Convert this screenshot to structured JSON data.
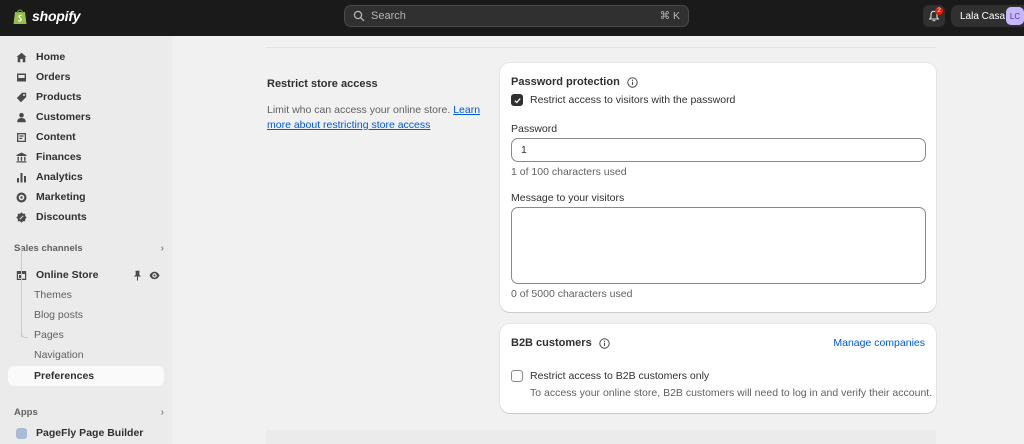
{
  "topbar": {
    "brand": "shopify",
    "search_placeholder": "Search",
    "search_shortcut": "⌘ K",
    "notifications_count": "2",
    "store_name": "Lala Casa",
    "avatar_initials": "LC"
  },
  "sidebar": {
    "items": [
      {
        "label": "Home",
        "icon": "home-icon"
      },
      {
        "label": "Orders",
        "icon": "orders-icon"
      },
      {
        "label": "Products",
        "icon": "products-icon"
      },
      {
        "label": "Customers",
        "icon": "customers-icon"
      },
      {
        "label": "Content",
        "icon": "content-icon"
      },
      {
        "label": "Finances",
        "icon": "finances-icon"
      },
      {
        "label": "Analytics",
        "icon": "analytics-icon"
      },
      {
        "label": "Marketing",
        "icon": "marketing-icon"
      },
      {
        "label": "Discounts",
        "icon": "discounts-icon"
      }
    ],
    "sales_channels_title": "Sales channels",
    "online_store_label": "Online Store",
    "online_store_subitems": [
      "Themes",
      "Blog posts",
      "Pages",
      "Navigation",
      "Preferences"
    ],
    "apps_title": "Apps",
    "app_item_label": "PageFly Page Builder"
  },
  "main": {
    "section_title": "Restrict store access",
    "section_desc": "Limit who can access your online store.",
    "section_link": "Learn more about restricting store access",
    "password_card": {
      "title": "Password protection",
      "checkbox_label": "Restrict access to visitors with the password",
      "password_label": "Password",
      "password_value": "1",
      "password_help": "1 of 100 characters used",
      "message_label": "Message to your visitors",
      "message_help": "0 of 5000 characters used"
    },
    "b2b_card": {
      "title": "B2B customers",
      "manage_link": "Manage companies",
      "checkbox_label": "Restrict access to B2B customers only",
      "checkbox_help": "To access your online store, B2B customers will need to log in and verify their account."
    }
  },
  "colors": {
    "topbar_bg": "#1a1a1a",
    "sidebar_bg": "#ebebeb",
    "page_bg": "#f1f1f1",
    "link": "#005bd3",
    "badge": "#e51c00"
  }
}
